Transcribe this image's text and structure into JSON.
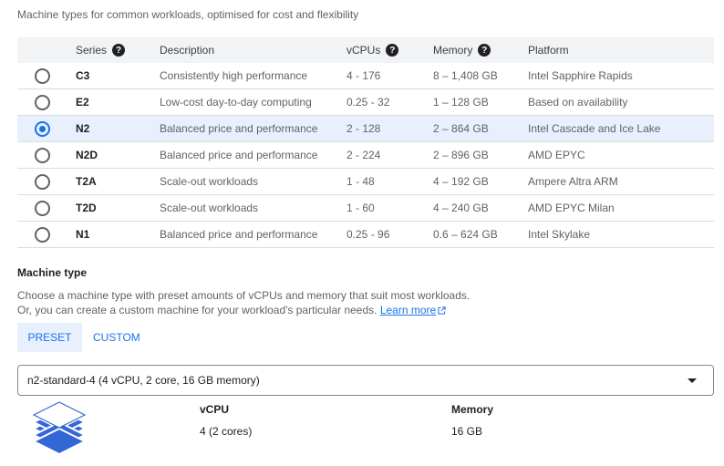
{
  "intro": "Machine types for common workloads, optimised for cost and flexibility",
  "table": {
    "headers": [
      "Series",
      "Description",
      "vCPUs",
      "Memory",
      "Platform"
    ],
    "help_glyph": "?",
    "rows": [
      {
        "series": "C3",
        "description": "Consistently high performance",
        "vcpus": "4 - 176",
        "memory": "8 – 1,408 GB",
        "platform": "Intel Sapphire Rapids",
        "selected": false
      },
      {
        "series": "E2",
        "description": "Low-cost day-to-day computing",
        "vcpus": "0.25 - 32",
        "memory": "1 – 128 GB",
        "platform": "Based on availability",
        "selected": false
      },
      {
        "series": "N2",
        "description": "Balanced price and performance",
        "vcpus": "2 - 128",
        "memory": "2 – 864 GB",
        "platform": "Intel Cascade and Ice Lake",
        "selected": true
      },
      {
        "series": "N2D",
        "description": "Balanced price and performance",
        "vcpus": "2 - 224",
        "memory": "2 – 896 GB",
        "platform": "AMD EPYC",
        "selected": false
      },
      {
        "series": "T2A",
        "description": "Scale-out workloads",
        "vcpus": "1 - 48",
        "memory": "4 – 192 GB",
        "platform": "Ampere Altra ARM",
        "selected": false
      },
      {
        "series": "T2D",
        "description": "Scale-out workloads",
        "vcpus": "1 - 60",
        "memory": "4 – 240 GB",
        "platform": "AMD EPYC Milan",
        "selected": false
      },
      {
        "series": "N1",
        "description": "Balanced price and performance",
        "vcpus": "0.25 - 96",
        "memory": "0.6 – 624 GB",
        "platform": "Intel Skylake",
        "selected": false
      }
    ]
  },
  "machine_type": {
    "title": "Machine type",
    "desc_line1": "Choose a machine type with preset amounts of vCPUs and memory that suit most workloads.",
    "desc_line2": "Or, you can create a custom machine for your workload's particular needs.",
    "learn_more": "Learn more",
    "tabs": {
      "preset": "PRESET",
      "custom": "CUSTOM"
    },
    "selected_value": "n2-standard-4 (4 vCPU, 2 core, 16 GB memory)",
    "vcpu_label": "vCPU",
    "vcpu_value": "4 (2 cores)",
    "memory_label": "Memory",
    "memory_value": "16 GB"
  },
  "colors": {
    "accent": "#1a73e8",
    "selected_row": "#e8f0fe",
    "icon_stack": "#3367d6"
  },
  "icons": {
    "help": "help-circle-icon",
    "external": "external-link-icon",
    "machine": "layers-stack-icon",
    "dropdown": "caret-down-icon"
  }
}
